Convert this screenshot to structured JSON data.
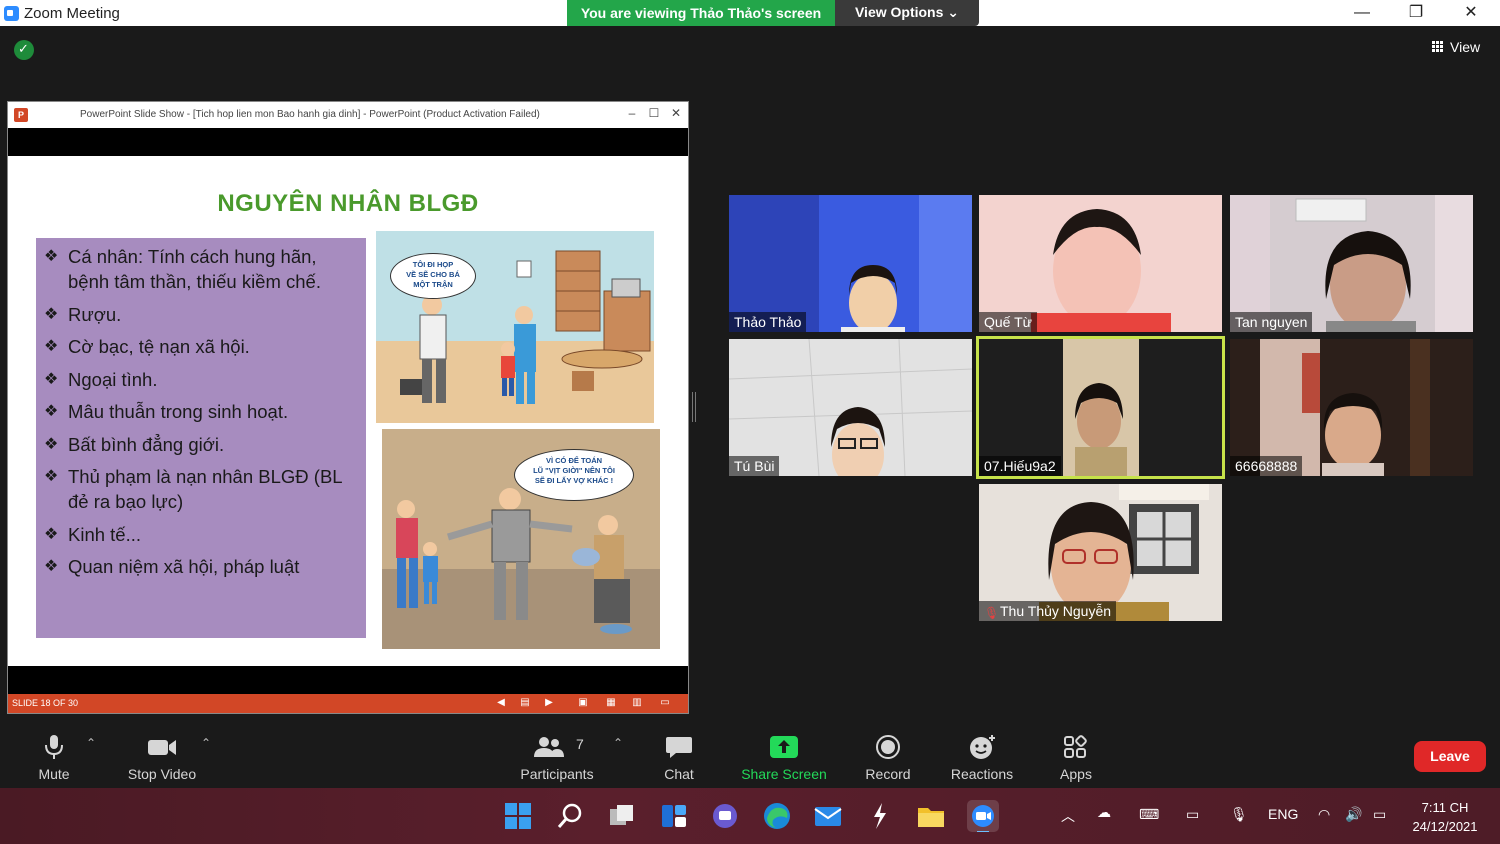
{
  "window": {
    "title": "Zoom Meeting",
    "minimize": "—",
    "restore": "❐",
    "close": "✕"
  },
  "banner": {
    "viewing": "You are viewing Thảo Thảo's screen",
    "view_options": "View Options ⌄"
  },
  "view_button": {
    "label": "View"
  },
  "ppt": {
    "window_title": "PowerPoint Slide Show - [Tich hop lien mon  Bao hanh gia dinh] - PowerPoint (Product Activation Failed)",
    "icon_letter": "P",
    "status": "SLIDE 18 OF 30",
    "slide": {
      "title": "NGUYÊN NHÂN BLGĐ",
      "bullet_mark": "❖",
      "bullets": [
        [
          "Cá nhân: Tính cách hung hãn,",
          "bệnh tâm thần, thiếu kiềm chế."
        ],
        [
          "Rượu."
        ],
        [
          "Cờ bạc, tệ nạn xã hội."
        ],
        [
          "Ngoại tình."
        ],
        [
          "Mâu thuẫn trong sinh hoạt."
        ],
        [
          "Bất bình đẳng giới."
        ],
        [
          "Thủ phạm là nạn nhân BLGĐ (BL",
          "đẻ ra bạo lực)"
        ],
        [
          "Kinh tế..."
        ],
        [
          "Quan niệm xã hội, pháp luật"
        ]
      ],
      "speech_1": [
        "TÔI ĐI HỌP",
        "VỀ SẼ CHO BÁ",
        "MỘT TRẬN"
      ],
      "speech_2": [
        "VÌ CÓ ĐỂ TOÁN",
        "LŨ \"VỊT GIỜI\" NÊN TÔI",
        "SẼ ĐI LẤY VỢ KHÁC !"
      ]
    }
  },
  "participants_tiles": [
    {
      "name": "Thảo Thảo",
      "bg": "#3a5be0"
    },
    {
      "name": "Quế Từ",
      "bg": "#f1c7c4"
    },
    {
      "name": "Tan nguyen",
      "bg": "#d8cfd0"
    },
    {
      "name": "Tú Bùi",
      "bg": "#dcdcdc"
    },
    {
      "name": "07.Hiếu9a2",
      "bg": "#1e1e1e"
    },
    {
      "name": "66668888",
      "bg": "#2a1d18"
    },
    {
      "name": "Thu Thủy Nguyễn",
      "bg": "#e8e2dc"
    }
  ],
  "toolbar": {
    "mute": "Mute",
    "stop_video": "Stop Video",
    "participants": "Participants",
    "participants_count": "7",
    "chat": "Chat",
    "share_screen": "Share Screen",
    "record": "Record",
    "reactions": "Reactions",
    "apps": "Apps",
    "leave": "Leave"
  },
  "taskbar": {
    "language": "ENG",
    "time": "7:11 CH",
    "date": "24/12/2021"
  },
  "colors": {
    "zoom_blue": "#2D8CFF",
    "banner_green": "#23a64a",
    "share_green": "#23d959",
    "leave_red": "#e02828",
    "ppt_orange": "#d24726",
    "active_speaker": "#c6e24a"
  }
}
